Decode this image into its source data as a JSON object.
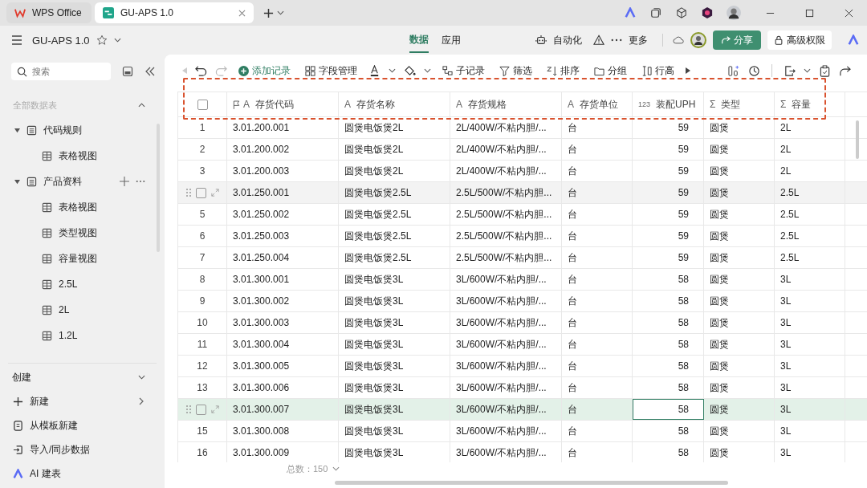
{
  "tabs": [
    {
      "label": "WPS Office",
      "kind": "wps",
      "selected": false
    },
    {
      "label": "GU-APS 1.0",
      "kind": "doc",
      "selected": true
    }
  ],
  "doc_title": "GU-APS 1.0",
  "views": [
    {
      "label": "数据",
      "selected": true
    },
    {
      "label": "应用",
      "selected": false
    }
  ],
  "actions": {
    "automation": "自动化",
    "more": "更多",
    "share": "分享",
    "permission": "高级权限"
  },
  "search": {
    "placeholder": "搜索"
  },
  "sidebar": {
    "section": "全部数据表",
    "tree": [
      {
        "label": "代码规则",
        "expanded": true,
        "children": [
          {
            "label": "表格视图"
          }
        ]
      },
      {
        "label": "产品资料",
        "expanded": true,
        "children": [
          {
            "label": "表格视图"
          },
          {
            "label": "类型视图"
          },
          {
            "label": "容量视图"
          },
          {
            "label": "2.5L"
          },
          {
            "label": "2L"
          },
          {
            "label": "1.2L"
          }
        ]
      }
    ],
    "create_title": "创建",
    "create": [
      {
        "label": "新建",
        "kind": "new"
      },
      {
        "label": "从模板新建",
        "kind": "template"
      },
      {
        "label": "导入/同步数据",
        "kind": "import"
      },
      {
        "label": "AI 建表",
        "kind": "ai"
      }
    ]
  },
  "toolbar": [
    {
      "label": "添加记录",
      "kind": "add"
    },
    {
      "label": "字段管理",
      "kind": "fields"
    },
    {
      "label": "子记录",
      "kind": "sub"
    },
    {
      "label": "筛选",
      "kind": "filter"
    },
    {
      "label": "排序",
      "kind": "sort"
    },
    {
      "label": "分组",
      "kind": "group"
    },
    {
      "label": "行高",
      "kind": "height"
    }
  ],
  "select_all": {
    "checked": false
  },
  "columns": [
    {
      "label": "存货代码",
      "kind": "primary",
      "type_icon": "A"
    },
    {
      "label": "存货名称",
      "kind": "text",
      "type_icon": "A"
    },
    {
      "label": "存货规格",
      "kind": "text",
      "type_icon": "A"
    },
    {
      "label": "存货单位",
      "kind": "text",
      "type_icon": "A"
    },
    {
      "label": "装配UPH",
      "kind": "number",
      "type_icon": "123"
    },
    {
      "label": "类型",
      "kind": "formula",
      "type_icon": "Σ"
    },
    {
      "label": "容量",
      "kind": "formula",
      "type_icon": "Σ"
    }
  ],
  "rows": [
    {
      "num": "1",
      "hovered": false,
      "selected": false,
      "cells": [
        "3.01.200.001",
        "圆煲电饭煲2L",
        "2L/400W/不粘内胆/...",
        "台",
        "59",
        "圆煲",
        "2L"
      ]
    },
    {
      "num": "2",
      "hovered": false,
      "selected": false,
      "cells": [
        "3.01.200.002",
        "圆煲电饭煲2L",
        "2L/400W/不粘内胆/...",
        "台",
        "59",
        "圆煲",
        "2L"
      ]
    },
    {
      "num": "3",
      "hovered": false,
      "selected": false,
      "cells": [
        "3.01.200.003",
        "圆煲电饭煲2L",
        "2L/400W/不粘内胆/...",
        "台",
        "59",
        "圆煲",
        "2L"
      ]
    },
    {
      "hovered": true,
      "selected": false,
      "cells": [
        "3.01.250.001",
        "圆煲电饭煲2.5L",
        "2.5L/500W/不粘内胆...",
        "台",
        "59",
        "圆煲",
        "2.5L"
      ]
    },
    {
      "num": "5",
      "hovered": false,
      "selected": false,
      "cells": [
        "3.01.250.002",
        "圆煲电饭煲2.5L",
        "2.5L/500W/不粘内胆...",
        "台",
        "59",
        "圆煲",
        "2.5L"
      ]
    },
    {
      "num": "6",
      "hovered": false,
      "selected": false,
      "cells": [
        "3.01.250.003",
        "圆煲电饭煲2.5L",
        "2.5L/500W/不粘内胆...",
        "台",
        "59",
        "圆煲",
        "2.5L"
      ]
    },
    {
      "num": "7",
      "hovered": false,
      "selected": false,
      "cells": [
        "3.01.250.004",
        "圆煲电饭煲2.5L",
        "2.5L/500W/不粘内胆...",
        "台",
        "59",
        "圆煲",
        "2.5L"
      ]
    },
    {
      "num": "8",
      "hovered": false,
      "selected": false,
      "cells": [
        "3.01.300.001",
        "圆煲电饭煲3L",
        "3L/600W/不粘内胆/...",
        "台",
        "58",
        "圆煲",
        "3L"
      ]
    },
    {
      "num": "9",
      "hovered": false,
      "selected": false,
      "cells": [
        "3.01.300.002",
        "圆煲电饭煲3L",
        "3L/600W/不粘内胆/...",
        "台",
        "58",
        "圆煲",
        "3L"
      ]
    },
    {
      "num": "10",
      "hovered": false,
      "selected": false,
      "cells": [
        "3.01.300.003",
        "圆煲电饭煲3L",
        "3L/600W/不粘内胆/...",
        "台",
        "58",
        "圆煲",
        "3L"
      ]
    },
    {
      "num": "11",
      "hovered": false,
      "selected": false,
      "cells": [
        "3.01.300.004",
        "圆煲电饭煲3L",
        "3L/600W/不粘内胆/...",
        "台",
        "58",
        "圆煲",
        "3L"
      ]
    },
    {
      "num": "12",
      "hovered": false,
      "selected": false,
      "cells": [
        "3.01.300.005",
        "圆煲电饭煲3L",
        "3L/600W/不粘内胆/...",
        "台",
        "58",
        "圆煲",
        "3L"
      ]
    },
    {
      "num": "13",
      "hovered": false,
      "selected": false,
      "cells": [
        "3.01.300.006",
        "圆煲电饭煲3L",
        "3L/600W/不粘内胆/...",
        "台",
        "58",
        "圆煲",
        "3L"
      ]
    },
    {
      "hovered": true,
      "selected": true,
      "cells": [
        "3.01.300.007",
        "圆煲电饭煲3L",
        "3L/600W/不粘内胆/...",
        "台",
        {
          "t": "58",
          "focused": true
        },
        "圆煲",
        "3L"
      ]
    },
    {
      "num": "15",
      "hovered": false,
      "selected": false,
      "cells": [
        "3.01.300.008",
        "圆煲电饭煲3L",
        "3L/600W/不粘内胆/...",
        "台",
        "58",
        "圆煲",
        "3L"
      ]
    },
    {
      "num": "16",
      "hovered": false,
      "selected": false,
      "cells": [
        "3.01.300.009",
        "圆煲电饭煲3L",
        "3L/600W/不粘内胆/...",
        "台",
        "58",
        "圆煲",
        "3L"
      ]
    }
  ],
  "total": "总数：150"
}
